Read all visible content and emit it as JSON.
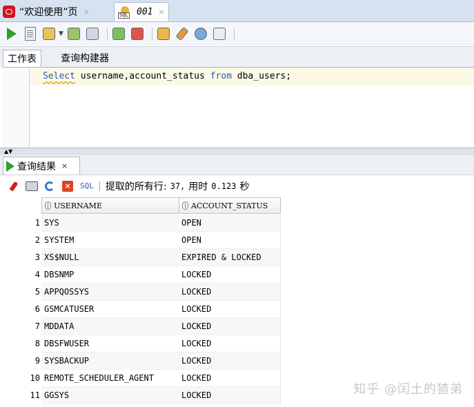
{
  "tabs": {
    "start_page": "“欢迎使用”页",
    "worksheet": "001",
    "close_glyph": "×"
  },
  "toolbar": {
    "buttons": [
      "run-statement-icon",
      "run-script-icon",
      "autotrace-icon",
      "explain-plan-icon",
      "sql-tuning-icon",
      "commit-icon",
      "rollback-icon",
      "sql-history-icon",
      "clear-icon",
      "tuning-advisor-icon",
      "format-icon"
    ]
  },
  "editor_tabs": {
    "worksheet": "工作表",
    "query_builder": "查询构建器"
  },
  "editor": {
    "keyword_select": "Select",
    "columns": " username,account_status ",
    "keyword_from": "from",
    "table": " dba_users;"
  },
  "splitter": {
    "arrows": "▲▼"
  },
  "results": {
    "tab_label": "查询结果",
    "close_glyph": "×",
    "sql_label": "SQL",
    "fetched_label": "提取的所有行:",
    "rows_count": "37,",
    "time_label": "用时",
    "time_value": "0.123",
    "seconds": "秒",
    "columns": [
      "USERNAME",
      "ACCOUNT_STATUS"
    ],
    "rows": [
      {
        "n": "1",
        "username": "SYS",
        "status": "OPEN"
      },
      {
        "n": "2",
        "username": "SYSTEM",
        "status": "OPEN"
      },
      {
        "n": "3",
        "username": "XS$NULL",
        "status": "EXPIRED & LOCKED"
      },
      {
        "n": "4",
        "username": "DBSNMP",
        "status": "LOCKED"
      },
      {
        "n": "5",
        "username": "APPQOSSYS",
        "status": "LOCKED"
      },
      {
        "n": "6",
        "username": "GSMCATUSER",
        "status": "LOCKED"
      },
      {
        "n": "7",
        "username": "MDDATA",
        "status": "LOCKED"
      },
      {
        "n": "8",
        "username": "DBSFWUSER",
        "status": "LOCKED"
      },
      {
        "n": "9",
        "username": "SYSBACKUP",
        "status": "LOCKED"
      },
      {
        "n": "10",
        "username": "REMOTE_SCHEDULER_AGENT",
        "status": "LOCKED"
      },
      {
        "n": "11",
        "username": "GGSYS",
        "status": "LOCKED"
      }
    ]
  },
  "watermark": "知乎 @闰土的猹弟",
  "colors": {
    "keyword": "#2a5bb5",
    "run_green": "#2ea12e",
    "oracle_red": "#d0141a"
  }
}
